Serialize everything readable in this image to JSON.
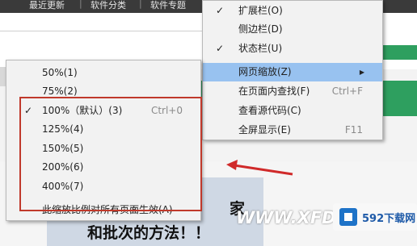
{
  "topnav": {
    "items": [
      "最近更新",
      "软件分类",
      "软件专题"
    ]
  },
  "browser_menu": {
    "items": [
      {
        "label": "扩展栏(O)",
        "checked": true,
        "shortcut": "",
        "submenu": false,
        "highlighted": false
      },
      {
        "label": "侧边栏(D)",
        "checked": false,
        "shortcut": "",
        "submenu": false,
        "highlighted": false
      },
      {
        "label": "状态栏(U)",
        "checked": true,
        "shortcut": "",
        "submenu": false,
        "highlighted": false
      },
      {
        "label": "网页缩放(Z)",
        "checked": false,
        "shortcut": "",
        "submenu": true,
        "highlighted": true
      },
      {
        "label": "在页面内查找(F)",
        "checked": false,
        "shortcut": "Ctrl+F",
        "submenu": false,
        "highlighted": false
      },
      {
        "label": "查看源代码(C)",
        "checked": false,
        "shortcut": "",
        "submenu": false,
        "highlighted": false
      },
      {
        "label": "全屏显示(E)",
        "checked": false,
        "shortcut": "F11",
        "submenu": false,
        "highlighted": false
      }
    ]
  },
  "zoom_menu": {
    "items": [
      {
        "label": "50%(1)",
        "checked": false,
        "shortcut": ""
      },
      {
        "label": "75%(2)",
        "checked": false,
        "shortcut": ""
      },
      {
        "label": "100%（默认）(3)",
        "checked": true,
        "shortcut": "Ctrl+0"
      },
      {
        "label": "125%(4)",
        "checked": false,
        "shortcut": ""
      },
      {
        "label": "150%(5)",
        "checked": false,
        "shortcut": ""
      },
      {
        "label": "200%(6)",
        "checked": false,
        "shortcut": ""
      },
      {
        "label": "400%(7)",
        "checked": false,
        "shortcut": ""
      },
      {
        "label": "此缩放比例对所有页面生效(A)",
        "checked": false,
        "shortcut": ""
      }
    ]
  },
  "article": {
    "line1_fragment": "家",
    "line2": "和批次的方法！！"
  },
  "watermark": {
    "text": "WWW.XFDC",
    "logo_text": "592下载网"
  },
  "colors": {
    "highlight": "#98c2f0",
    "annotation_red": "#c0392b",
    "green_band": "#2e9f5f"
  },
  "check_glyph": "✓",
  "arrow_glyph": "▶"
}
